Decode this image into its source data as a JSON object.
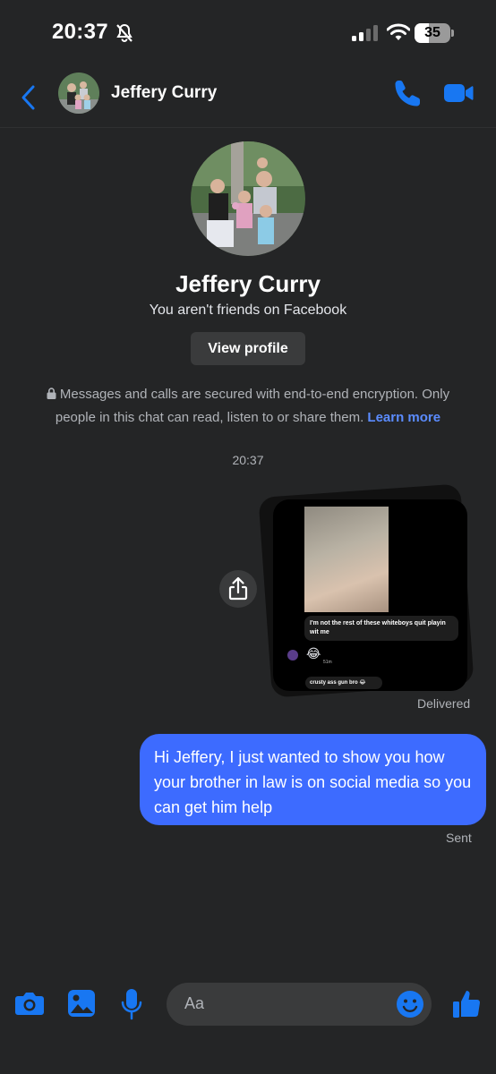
{
  "status_bar": {
    "time": "20:37",
    "battery": "35"
  },
  "header": {
    "name": "Jeffery Curry"
  },
  "profile": {
    "name": "Jeffery Curry",
    "subtitle": "You aren't friends on Facebook",
    "view_profile_label": "View profile"
  },
  "encryption": {
    "text": "Messages and calls are secured with end-to-end encryption. Only people in this chat can read, listen to or share them.",
    "link": "Learn more"
  },
  "timestamp": "20:37",
  "shared_image": {
    "caption": "I'm not the rest of these whiteboys quit playin wit me",
    "emoji": "😂",
    "time": "51m",
    "reply": "crusty ass gun bro 😂"
  },
  "messages": [
    {
      "status": "Delivered"
    },
    {
      "text": "Hi Jeffery, I just wanted to show you how your brother in law is on social media so you can get him help",
      "status": "Sent"
    }
  ],
  "composer": {
    "placeholder": "Aa"
  },
  "colors": {
    "accent": "#3d6bff",
    "icon_blue": "#1877f2",
    "link": "#5b8cff",
    "background": "#242526"
  }
}
